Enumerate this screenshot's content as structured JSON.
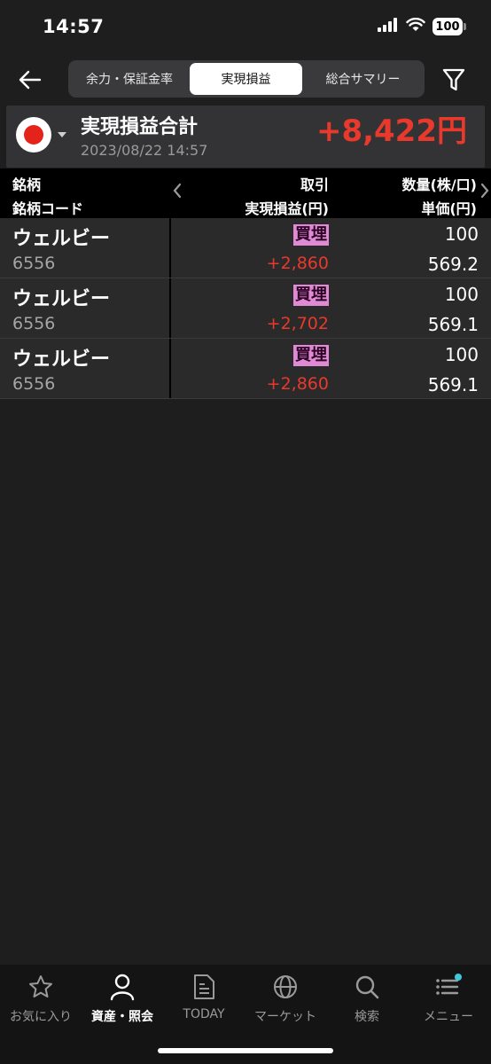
{
  "status": {
    "time": "14:57",
    "battery": "100"
  },
  "header": {
    "tabs": [
      {
        "label": "余力・保証金率",
        "active": false
      },
      {
        "label": "実現損益",
        "active": true
      },
      {
        "label": "総合サマリー",
        "active": false
      }
    ]
  },
  "summary": {
    "title": "実現損益合計",
    "date": "2023/08/22 14:57",
    "total": "+8,422円",
    "total_color": "#e8392c"
  },
  "columns": {
    "col1_top": "銘柄",
    "col1_bottom": "銘柄コード",
    "col2_top": "取引",
    "col2_bottom": "実現損益(円)",
    "col3_top": "数量(株/口)",
    "col3_bottom": "単価(円)"
  },
  "rows": [
    {
      "name": "ウェルビー",
      "code": "6556",
      "type": "買埋",
      "pl": "+2,860",
      "qty": "100",
      "price": "569.2"
    },
    {
      "name": "ウェルビー",
      "code": "6556",
      "type": "買埋",
      "pl": "+2,702",
      "qty": "100",
      "price": "569.1"
    },
    {
      "name": "ウェルビー",
      "code": "6556",
      "type": "買埋",
      "pl": "+2,860",
      "qty": "100",
      "price": "569.1"
    }
  ],
  "nav": {
    "items": [
      {
        "label": "お気に入り",
        "icon": "star-icon",
        "active": false
      },
      {
        "label": "資産・照会",
        "icon": "person-icon",
        "active": true
      },
      {
        "label": "TODAY",
        "icon": "document-icon",
        "active": false
      },
      {
        "label": "マーケット",
        "icon": "globe-icon",
        "active": false
      },
      {
        "label": "検索",
        "icon": "search-icon",
        "active": false
      },
      {
        "label": "メニュー",
        "icon": "menu-icon",
        "active": false
      }
    ]
  },
  "colors": {
    "accent_red": "#e8392c",
    "trade_badge": "#e08ad6",
    "notification_dot": "#3ec8d8"
  }
}
